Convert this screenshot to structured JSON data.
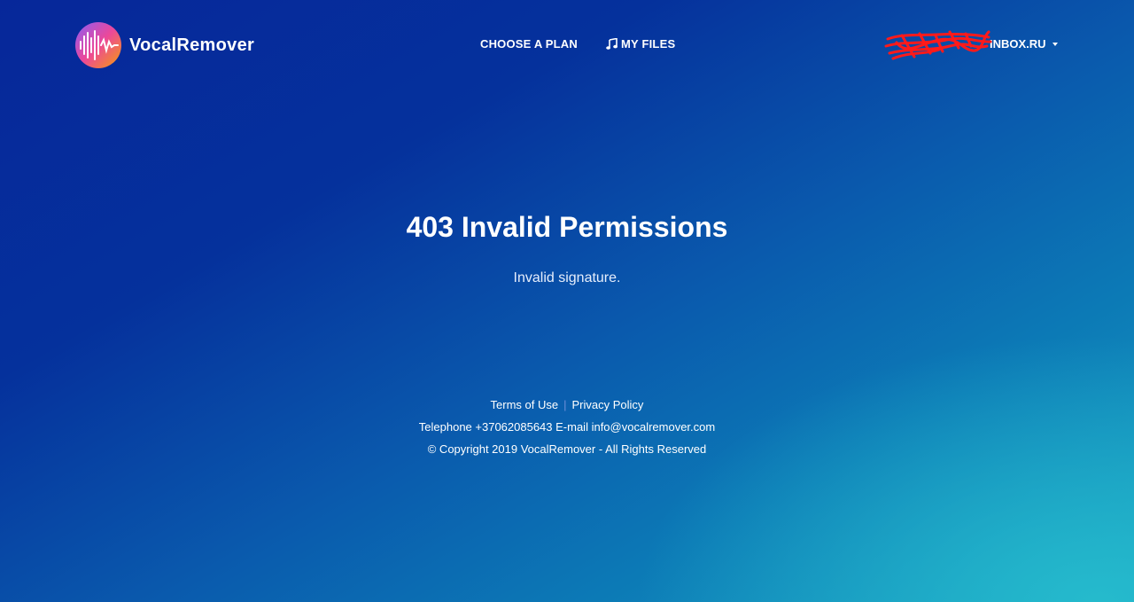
{
  "header": {
    "logo_text": "VocalRemover",
    "nav": {
      "choose_plan": "CHOOSE A PLAN",
      "my_files": "MY FILES"
    },
    "account": {
      "email_visible_suffix": "INBOX.RU"
    }
  },
  "main": {
    "title": "403 Invalid Permissions",
    "message": "Invalid signature."
  },
  "footer": {
    "terms": "Terms of Use",
    "separator": "|",
    "privacy": "Privacy Policy",
    "contact": "Telephone +37062085643 E-mail info@vocalremover.com",
    "copyright": "© Copyright 2019 VocalRemover - All Rights Reserved"
  },
  "icons": {
    "logo": "waveform-logo-icon",
    "files": "music-note-icon",
    "dropdown": "caret-down-icon"
  },
  "colors": {
    "background_top": "#06279a",
    "background_bottom_right": "#26bccd",
    "text": "#ffffff",
    "redaction": "#ff1a1a"
  }
}
